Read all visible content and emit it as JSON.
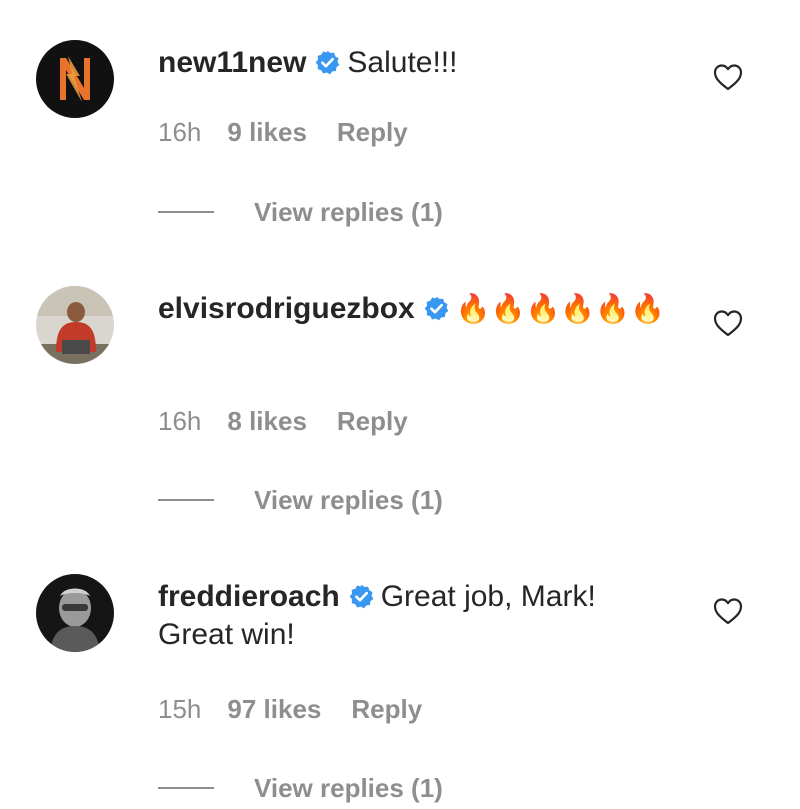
{
  "comments": [
    {
      "username": "new11new",
      "text": "Salute!!!",
      "time": "16h",
      "likes": "9 likes",
      "reply": "Reply",
      "view_replies": "View replies (1)"
    },
    {
      "username": "elvisrodriguezbox",
      "text": "🔥🔥🔥🔥🔥🔥",
      "time": "16h",
      "likes": "8 likes",
      "reply": "Reply",
      "view_replies": "View replies (1)"
    },
    {
      "username": "freddieroach",
      "text": "Great job, Mark! Great win!",
      "time": "15h",
      "likes": "97 likes",
      "reply": "Reply",
      "view_replies": "View replies (1)"
    }
  ],
  "icons": {
    "verified": "verified-badge-icon",
    "like": "heart-outline-icon"
  },
  "colors": {
    "verified": "#3897f0",
    "meta_text": "#8e8e8e",
    "primary_text": "#262626",
    "fire": "#f26a1b"
  }
}
